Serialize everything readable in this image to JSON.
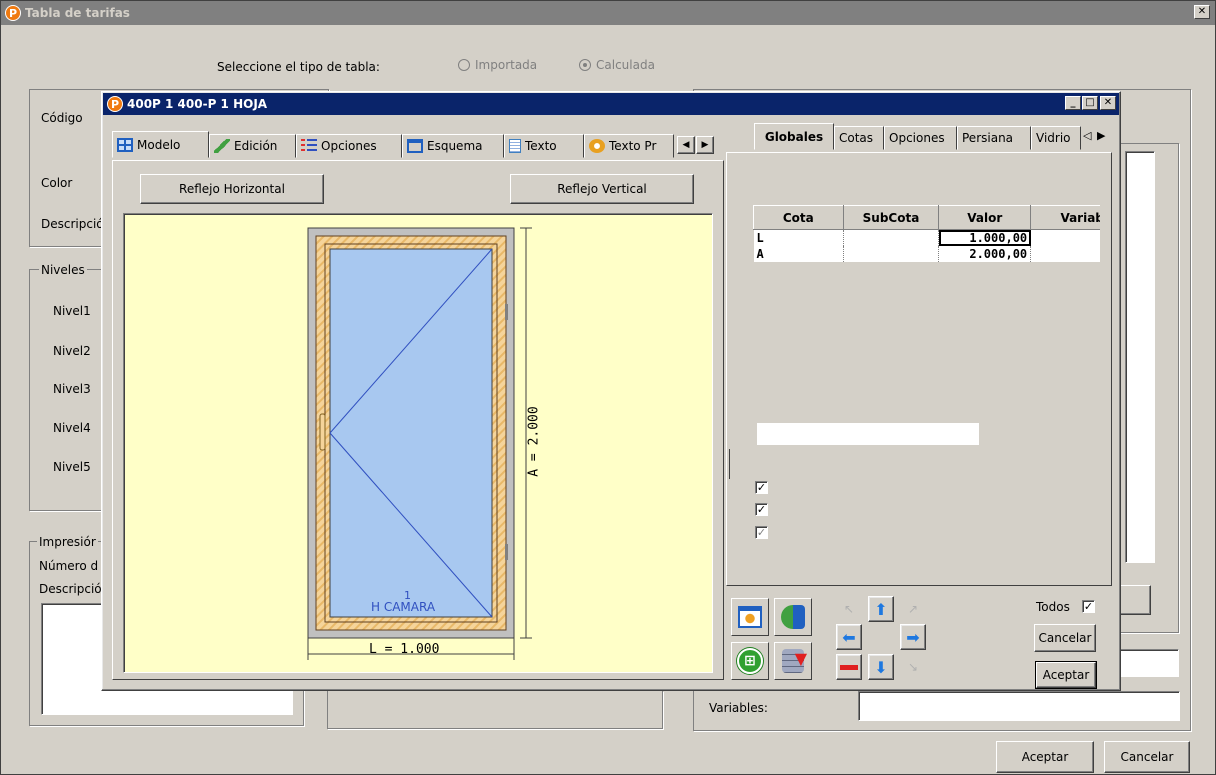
{
  "main_window": {
    "title": "Tabla de tarifas",
    "close_label": "✕",
    "table_type_label": "Seleccione el tipo de tabla:",
    "radio_importada": "Importada",
    "radio_calculada": "Calculada",
    "codigo_label": "Código",
    "color_label": "Color",
    "descripcion_label": "Descripció",
    "niveles_label": "Niveles",
    "niveles": [
      "Nivel1",
      "Nivel2",
      "Nivel3",
      "Nivel4",
      "Nivel5"
    ],
    "impresion_label": "Impresiór",
    "numero_label": "Número d",
    "descripcion2_label": "Descripció",
    "variables_label": "Variables:",
    "aceptar_label": "Aceptar",
    "cancelar_label": "Cancelar"
  },
  "dialog": {
    "title": "400P 1 400-P 1 HOJA",
    "left_tabs": [
      "Modelo",
      "Edición",
      "Opciones",
      "Esquema",
      "Texto",
      "Texto Pr"
    ],
    "reflejo_horizontal": "Reflejo Horizontal",
    "reflejo_vertical": "Reflejo Vertical",
    "drawing": {
      "dim_height": "A = 2.000",
      "dim_width": "L = 1.000",
      "glass_label": "H CAMARA",
      "leaf_number": "1"
    },
    "right_tabs": [
      "Globales",
      "Cotas",
      "Opciones",
      "Persiana",
      "Vidrio"
    ],
    "grid": {
      "headers": [
        "Cota",
        "SubCota",
        "Valor",
        "Variabl"
      ],
      "rows": [
        {
          "cota": "L",
          "subcota": "",
          "valor": "1.000,00",
          "variable": ""
        },
        {
          "cota": "A",
          "subcota": "",
          "valor": "2.000,00",
          "variable": ""
        }
      ]
    },
    "checks": [
      true,
      true,
      true
    ],
    "todos_label": "Todos",
    "todos_checked": true,
    "cancelar_label": "Cancelar",
    "aceptar_label": "Aceptar"
  },
  "colors": {
    "title_active": "#0a246a",
    "title_inactive": "#808080",
    "drawing_bg": "#ffffc8",
    "glass": "#a8c8f0",
    "frame_wood": "#f5d49a",
    "arrow_blue": "#1e78e0",
    "minus_red": "#e02020"
  }
}
